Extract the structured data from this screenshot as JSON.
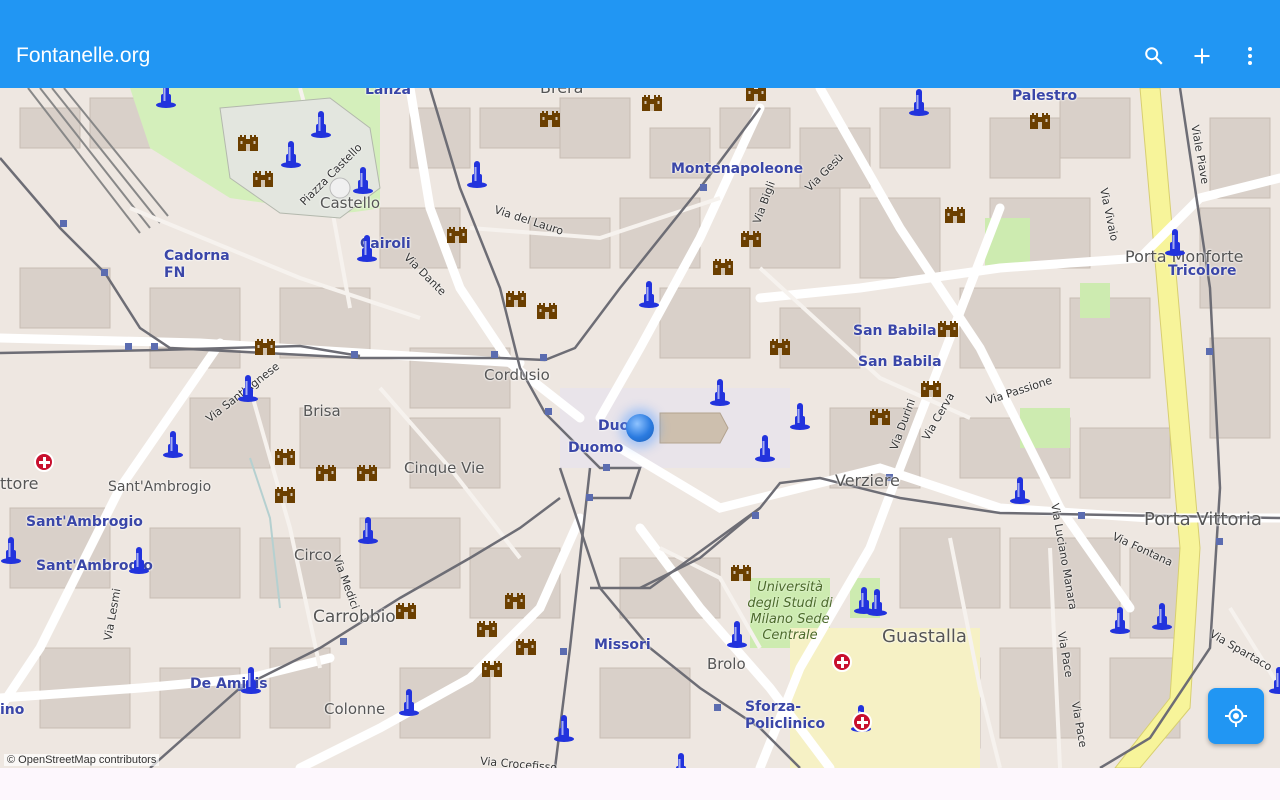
{
  "appbar": {
    "title": "Fontanelle.org",
    "actions": [
      {
        "name": "search-icon"
      },
      {
        "name": "add-icon"
      },
      {
        "name": "more-vert-icon"
      }
    ]
  },
  "map": {
    "attribution": "© OpenStreetMap contributors",
    "places": [
      "Castello",
      "Cordusio",
      "Brisa",
      "Cinque Vie",
      "Sant'Ambrogio",
      "Circo",
      "Carrobbio",
      "Colonne",
      "Brolo",
      "Guastalla",
      "Verziere",
      "Porta Vittoria",
      "Porta Monforte",
      "Duomo",
      "Brera",
      "Lanza",
      "Palestro",
      "ttore",
      "ino"
    ],
    "stations": [
      "Cadorna FN",
      "Cairoli",
      "Montenapoleone",
      "San Babila",
      "Duomo",
      "Sant'Ambrogio",
      "Missori",
      "De Amicis",
      "Sforza-Policlinico",
      "Tricolore",
      "Palestro"
    ],
    "streets": [
      "Piazza Castello",
      "Via del Lauro",
      "Via Dante",
      "Via Sant'Agnese",
      "Via Gesù",
      "Via Bigli",
      "Via Vivaio",
      "Via Passione",
      "Via Durini",
      "Via Cerva",
      "Via Fontana",
      "Via Medici",
      "Via Lesmi",
      "Via Luciano Manara",
      "Via Pace",
      "Via Spartaco",
      "Via Crocefisso",
      "Viale Piave",
      "Via Pace"
    ],
    "university_label": "Università degli Studi di Milano Sede Centrale",
    "fountain_color": "#2233dd",
    "landmark_color": "#6b3f00",
    "hospital_color": "#c8102e"
  },
  "fab": {
    "name": "my-location-icon"
  }
}
